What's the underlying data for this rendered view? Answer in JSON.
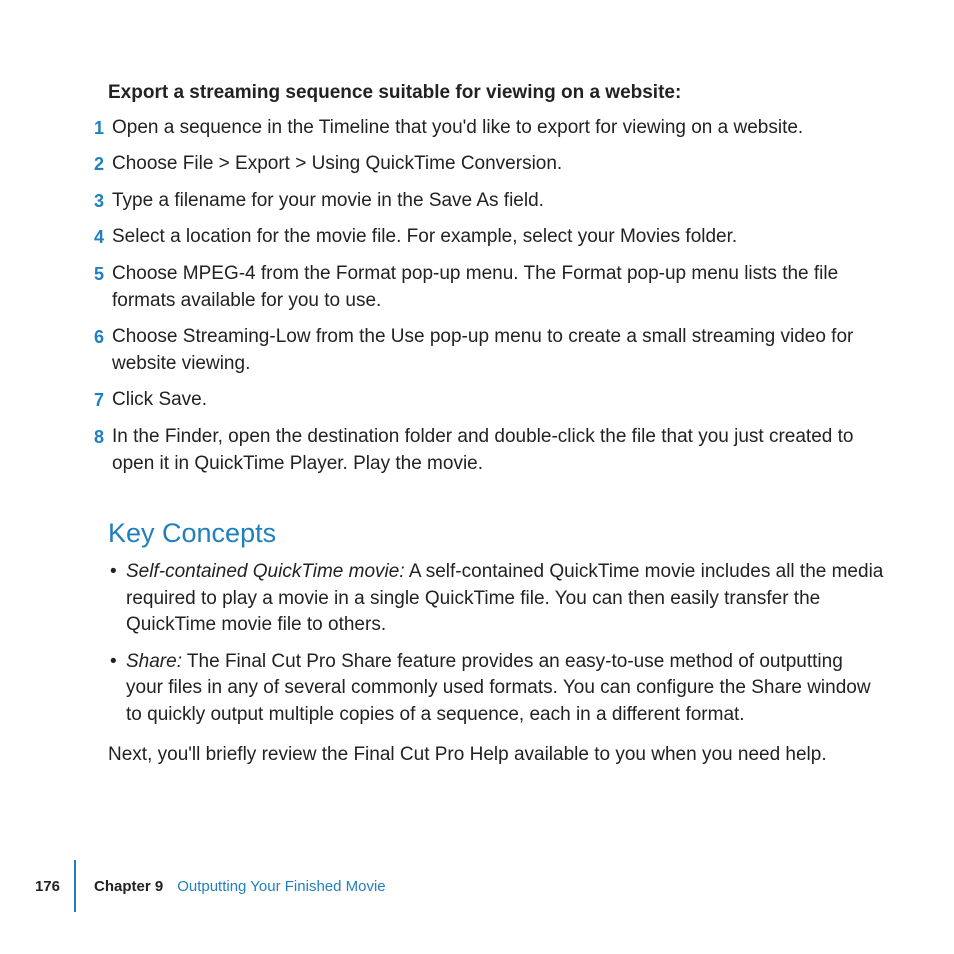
{
  "intro_heading": "Export a streaming sequence suitable for viewing on a website:",
  "steps": [
    "Open a sequence in the Timeline that you'd like to export for viewing on a website.",
    "Choose File > Export > Using QuickTime Conversion.",
    "Type a filename for your movie in the Save As field.",
    "Select a location for the movie file. For example, select your Movies folder.",
    "Choose MPEG-4 from the Format pop-up menu. The Format pop-up menu lists the file formats available for you to use.",
    "Choose Streaming-Low from the Use pop-up menu to create a small streaming video for website viewing.",
    "Click Save.",
    "In the Finder, open the destination folder and double-click the file that you just created to open it in QuickTime Player. Play the movie."
  ],
  "section_heading": "Key Concepts",
  "concepts": [
    {
      "term": "Self-contained QuickTime movie:",
      "desc": "  A self-contained QuickTime movie includes all the media required to play a movie in a single QuickTime file. You can then easily transfer the QuickTime movie file to others."
    },
    {
      "term": "Share:",
      "desc": "  The Final Cut Pro Share feature provides an easy-to-use method of outputting your files in any of several commonly used formats. You can configure the Share window to quickly output multiple copies of a sequence, each in a different format."
    }
  ],
  "after_concepts": "Next, you'll briefly review the Final Cut Pro Help available to you when you need help.",
  "footer": {
    "page_number": "176",
    "chapter_label": "Chapter 9",
    "chapter_title": "Outputting Your Finished Movie"
  }
}
